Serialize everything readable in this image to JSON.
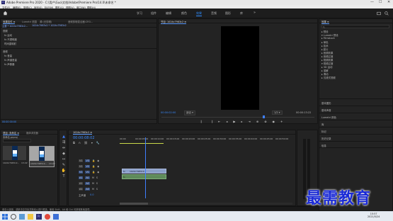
{
  "window": {
    "title": "Adobe Premiere Pro 2020 - C:\\用户\\Guo\\文档\\Adobe\\Premiere Pro\\14.0\\未命名 *",
    "logo": "Pr",
    "controls": [
      "—",
      "☐",
      "✕"
    ]
  },
  "menu": [
    "文件(F)",
    "编辑(E)",
    "剪辑(C)",
    "序列(S)",
    "标记(M)",
    "图形(G)",
    "视图(V)",
    "窗口(W)",
    "帮助(H)"
  ],
  "workspaces": {
    "tabs": [
      "学习",
      "组件",
      "编辑",
      "颜色",
      "效果",
      "音频",
      "图形",
      "库"
    ],
    "active_index": 4
  },
  "effect_controls": {
    "tabs": [
      "效果控件 ≡",
      "Lumetri 范围",
      "源:(无剪辑)",
      "音频剪辑混合器:CR3..."
    ],
    "master_label": "主要 * 1024c7983c2...",
    "sequence_label": "1024c7983c2 * 1024c7983c2",
    "video_header": "视频",
    "video_items": [
      "fx 运动",
      "fx 不透明度",
      "时间重映射"
    ],
    "audio_header": "音频",
    "audio_items": [
      "fx 音量",
      "fx 声道音量",
      "fx 声像器"
    ],
    "timecode": "00:00:00:00"
  },
  "program_monitor": {
    "title": "节目: 1024c7983c2 ≡",
    "timecode_left": "00:00:02:00",
    "fit": "适合",
    "quality": "完整",
    "timecode_right": "00:00:13:22",
    "zoom": "1/2"
  },
  "project": {
    "tabs": [
      "项目: 未命名 ≡",
      "媒体浏览器"
    ],
    "path": "未命名.prproj",
    "search_placeholder": "",
    "items": [
      {
        "name": "1024c7983c2...",
        "duration": "13:22"
      },
      {
        "name": "1024c7983c2...",
        "duration": "13:22"
      }
    ],
    "item_count": "1 项已选择，共 2 项"
  },
  "timeline": {
    "title": "1024c7983c2 ≡",
    "timecode": "00:00:08:02",
    "ruler": [
      "00:00",
      "00:00:05:00",
      "00:00:10:00",
      "00:00:15:00",
      "00:00:20:00",
      "00:00:25:00",
      "00:00:30:00",
      "00:00:35:00",
      "00:00:40:00",
      "00:00:45:00",
      "00:00:50:00"
    ],
    "tracks": [
      "V3",
      "V2",
      "V1",
      "A1",
      "A2",
      "A3"
    ],
    "master": "主声道",
    "master_value": "0.0",
    "clip_video": "1024c7983c2...",
    "clip_audio": ""
  },
  "effects_panel": {
    "title": "效果 ≡",
    "search_placeholder": "",
    "tree": [
      "▸ 预设",
      "▾ Lumetri 预设",
      "  ▸ Filmstock",
      "  ▸ 单色",
      "  ▸ 技术",
      "  ▸ 影片",
      "  ▸ 音频效果",
      "▸ 音频过渡",
      "▸ 视频效果",
      "▾ 视频过渡",
      "  ▸ 3D 运动",
      "  ▸ 溶解",
      "  ▸ 滑动",
      "▸ 沉浸式视频"
    ],
    "sections": [
      "基本图形",
      "基本声音",
      "Lumetri 颜色",
      "库",
      "标记",
      "历史记录",
      "信息"
    ]
  },
  "status_bar": {
    "text": "单击以选择，或单击空白处并拖动以进行框选。使用 Shift、Alt 和 Ctrl 可获得其他选项。"
  },
  "watermark": "最需教育",
  "taskbar": {
    "time": "15:57",
    "date": "2021/5/24"
  },
  "colors": {
    "accent": "#2e8cff",
    "panel_bg": "#232323",
    "clip_video": "#8ba0c9",
    "clip_audio": "#5e8a5a",
    "playhead": "#3f7fff",
    "work_area": "#c8d84a",
    "watermark": "#1a2ad6"
  }
}
